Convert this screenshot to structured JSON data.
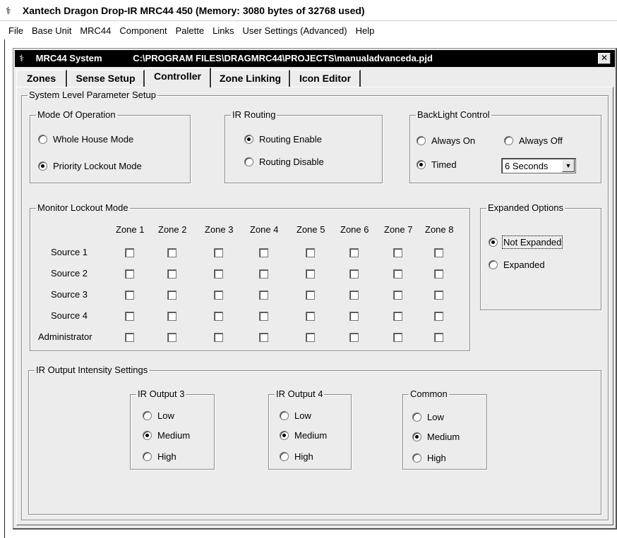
{
  "app": {
    "title": "Xantech Dragon Drop-IR MRC44 450 (Memory: 3080 bytes of 32768 used)"
  },
  "menu": [
    "File",
    "Base Unit",
    "MRC44",
    "Component",
    "Palette",
    "Links",
    "User Settings (Advanced)",
    "Help"
  ],
  "child": {
    "title": "MRC44 System",
    "path": "C:\\PROGRAM FILES\\DRAGMRC44\\PROJECTS\\manualadvanceda.pjd",
    "close_glyph": "✕"
  },
  "tabs": [
    "Zones",
    "Sense Setup",
    "Controller",
    "Zone Linking",
    "Icon Editor"
  ],
  "active_tab": "Controller",
  "system": {
    "label": "System Level Parameter Setup"
  },
  "mode": {
    "label": "Mode Of Operation",
    "options": [
      {
        "label": "Whole House Mode",
        "selected": false
      },
      {
        "label": "Priority Lockout Mode",
        "selected": true
      }
    ]
  },
  "ir_routing": {
    "label": "IR Routing",
    "options": [
      {
        "label": "Routing Enable",
        "selected": true
      },
      {
        "label": "Routing Disable",
        "selected": false
      }
    ]
  },
  "backlight": {
    "label": "BackLight Control",
    "always_on": "Always On",
    "always_off": "Always Off",
    "timed": "Timed",
    "selected": "Timed",
    "timeout_value": "6 Seconds"
  },
  "monitor": {
    "label": "Monitor Lockout Mode",
    "zones": [
      "Zone 1",
      "Zone 2",
      "Zone 3",
      "Zone 4",
      "Zone 5",
      "Zone 6",
      "Zone 7",
      "Zone 8"
    ],
    "sources": [
      "Source 1",
      "Source 2",
      "Source 3",
      "Source 4",
      "Administrator"
    ]
  },
  "expanded": {
    "label": "Expanded Options",
    "options": [
      {
        "label": "Not Expanded",
        "selected": true
      },
      {
        "label": "Expanded",
        "selected": false
      }
    ]
  },
  "ir_output": {
    "label": "IR Output Intensity Settings",
    "groups": [
      {
        "label": "IR Output 3",
        "options": [
          "Low",
          "Medium",
          "High"
        ],
        "selected": "Medium"
      },
      {
        "label": "IR Output 4",
        "options": [
          "Low",
          "Medium",
          "High"
        ],
        "selected": "Medium"
      },
      {
        "label": "Common",
        "options": [
          "Low",
          "Medium",
          "High"
        ],
        "selected": "Medium"
      }
    ]
  }
}
